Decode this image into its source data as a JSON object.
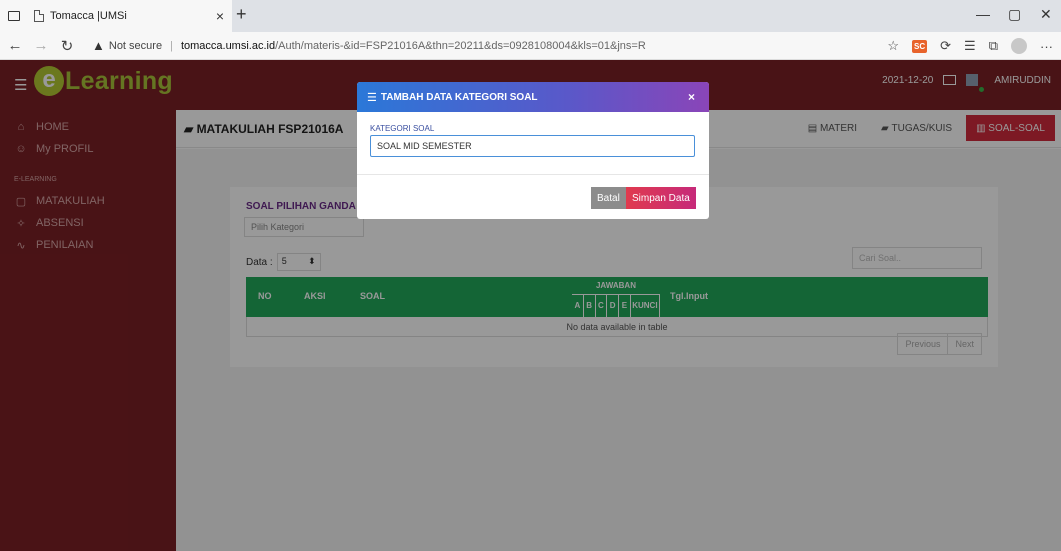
{
  "browser": {
    "tab_title": "Tomacca |UMSi",
    "tab_close": "×",
    "new_tab": "+",
    "not_secure": "Not secure",
    "url_host": "tomacca.umsi.ac.id",
    "url_path": "/Auth/materis-&id=FSP21016A&thn=20211&ds=0928108004&kls=01&jns=R",
    "badge": "SC"
  },
  "header": {
    "logo_e": "e",
    "logo_text": "Learning",
    "date": "2021-12-20",
    "user": "AMIRUDDIN"
  },
  "sidebar": {
    "items": [
      {
        "icon": "⌂",
        "label": "HOME"
      },
      {
        "icon": "☺",
        "label": "My PROFIL"
      }
    ],
    "section": "E-LEARNING",
    "menu": [
      {
        "icon": "▢",
        "label": "MATAKULIAH"
      },
      {
        "icon": "✧",
        "label": "ABSENSI"
      },
      {
        "icon": "∿",
        "label": "PENILAIAN"
      }
    ]
  },
  "main": {
    "title": "MATAKULIAH FSP21016A",
    "tabs": [
      {
        "label": "MATERI",
        "icon": "▤"
      },
      {
        "label": "TUGAS/KUIS",
        "icon": "▰"
      },
      {
        "label": "SOAL-SOAL",
        "icon": "▥"
      }
    ],
    "soal_title": "SOAL PILIHAN GANDA",
    "kategori_placeholder": "Pilih Kategori",
    "data_label": "Data :",
    "data_value": "5",
    "search_placeholder": "Cari Soal..",
    "table": {
      "col_no": "NO",
      "col_aksi": "AKSI",
      "col_soal": "SOAL",
      "col_jawaban": "JAWABAN",
      "jawaban_cols": [
        "A",
        "B",
        "C",
        "D",
        "E",
        "KUNCI"
      ],
      "col_tgl": "Tgl.Input",
      "empty": "No data available in table"
    },
    "pager": {
      "previous": "Previous",
      "next": "Next"
    }
  },
  "modal": {
    "title": "TAMBAH DATA KATEGORI SOAL",
    "close": "×",
    "field_label": "KATEGORI SOAL",
    "field_value": "SOAL MID SEMESTER",
    "cancel": "Batal",
    "save": "Simpan Data"
  }
}
